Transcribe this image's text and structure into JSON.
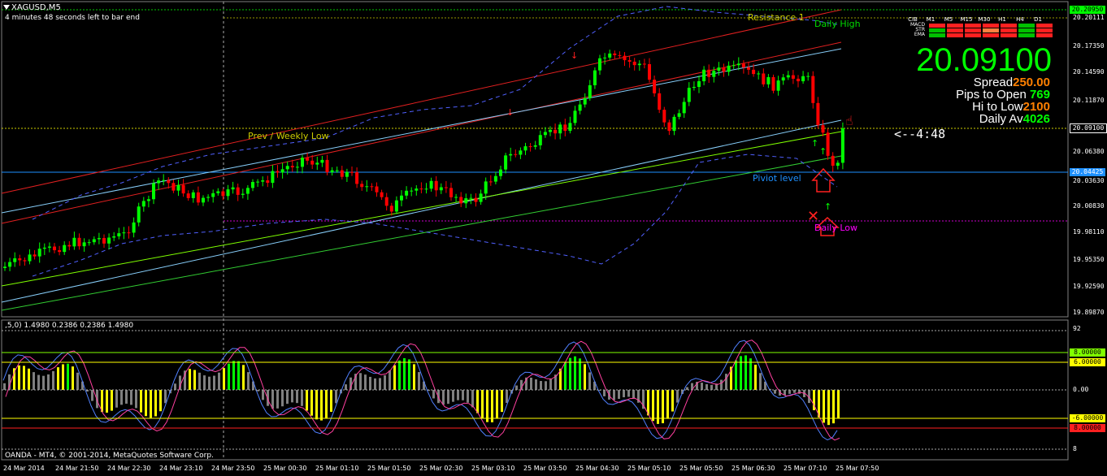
{
  "window": {
    "symbol": "XAGUSD,M5"
  },
  "info": {
    "bar_left": "4 minutes 48 seconds left to bar end"
  },
  "panel": {
    "price": "20.09100",
    "spread_label": "Spread",
    "spread_value": "250.00",
    "pips_label": "Pips to Open",
    "pips_value": "769",
    "hilo_label": "Hi to Low",
    "hilo_value": "2100",
    "daily_label": "Daily Av",
    "daily_value": "4026"
  },
  "mtf": {
    "header": [
      "CIB",
      "M1",
      "M5",
      "M15",
      "M30",
      "H1",
      "H4",
      "D1"
    ],
    "rows": [
      {
        "label": "MACD",
        "colors": [
          "#ff2020",
          "#ff2020",
          "#ff2020",
          "#ff2020",
          "#ff2020",
          "#00c000",
          "#ff2020"
        ]
      },
      {
        "label": "STR",
        "colors": [
          "#00c000",
          "#ff2020",
          "#ff2020",
          "#ff8040",
          "#ff2020",
          "#00c000",
          "#ff2020"
        ]
      },
      {
        "label": "EMA",
        "colors": [
          "#00c000",
          "#ff2020",
          "#ff2020",
          "#ff2020",
          "#ff2020",
          "#00c000",
          "#ff2020"
        ]
      }
    ]
  },
  "countdown": "<--4:48",
  "levels": {
    "resistance": "Resistance 1",
    "daily_high": "Daily High",
    "weekly_low": "Prev / Weekly Low",
    "pivot": "Piviot level",
    "daily_low": "Daily Low"
  },
  "colors": {
    "bull": "#00ff00",
    "bear": "#ff0000",
    "pivot": "#1e90ff",
    "daily_high": "#00ff00",
    "daily_low": "#ff00ff",
    "price_line": "#ffff00"
  },
  "yaxis": {
    "main": [
      "20.20111",
      "20.17350",
      "20.14590",
      "20.11870",
      "20.06380",
      "20.03630",
      "20.00830",
      "19.98110",
      "19.95350",
      "19.92590",
      "19.89870"
    ],
    "main_tags": {
      "daily_high": "20.20950",
      "price": "20.09100",
      "pivot": "20.04425"
    },
    "ind": [
      "92",
      "0.00",
      "8"
    ],
    "ind_tags": {
      "up1": "8.00000",
      "up2": "6.00000",
      "dn1": "-6.00000",
      "dn2": "8.00000"
    }
  },
  "indicator": {
    "label": ",5,0) 1.4980 0.2386 0.2386 1.4980"
  },
  "xaxis": [
    "24 Mar 2014",
    "24 Mar 21:50",
    "24 Mar 22:30",
    "24 Mar 23:10",
    "24 Mar 23:50",
    "25 Mar 00:30",
    "25 Mar 01:10",
    "25 Mar 01:50",
    "25 Mar 02:30",
    "25 Mar 03:10",
    "25 Mar 03:50",
    "25 Mar 04:30",
    "25 Mar 05:10",
    "25 Mar 05:50",
    "25 Mar 06:30",
    "25 Mar 07:10",
    "25 Mar 07:50"
  ],
  "footer": "OANDA - MT4, © 2001-2014, MetaQuotes Software Corp."
}
